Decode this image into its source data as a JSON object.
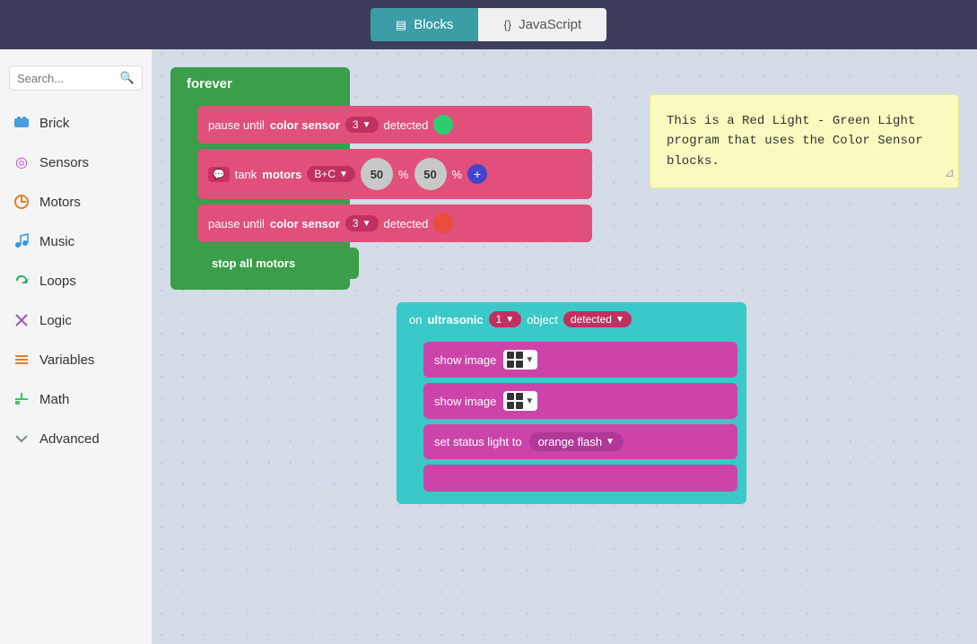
{
  "header": {
    "blocks_tab": "Blocks",
    "js_tab": "JavaScript",
    "blocks_icon": "▤",
    "js_icon": "{}"
  },
  "sidebar": {
    "search_placeholder": "Search...",
    "items": [
      {
        "id": "brick",
        "label": "Brick",
        "icon": "⬛",
        "color": "icon-brick"
      },
      {
        "id": "sensors",
        "label": "Sensors",
        "icon": "◎",
        "color": "icon-sensors"
      },
      {
        "id": "motors",
        "label": "Motors",
        "icon": "↻",
        "color": "icon-motors"
      },
      {
        "id": "music",
        "label": "Music",
        "icon": "♪",
        "color": "icon-music"
      },
      {
        "id": "loops",
        "label": "Loops",
        "icon": "↺",
        "color": "icon-loops"
      },
      {
        "id": "logic",
        "label": "Logic",
        "icon": "✕",
        "color": "icon-logic"
      },
      {
        "id": "variables",
        "label": "Variables",
        "icon": "≡",
        "color": "icon-variables"
      },
      {
        "id": "math",
        "label": "Math",
        "icon": "±",
        "color": "icon-math"
      },
      {
        "id": "advanced",
        "label": "Advanced",
        "icon": "∨",
        "color": "icon-advanced"
      }
    ]
  },
  "canvas": {
    "forever_label": "forever",
    "pause_until": "pause until",
    "color_sensor": "color sensor",
    "detected": "detected",
    "sensor_num_1": "3",
    "sensor_num_2": "3",
    "tank_motors": "tank",
    "motors_keyword": "motors",
    "motors_config": "B+C",
    "percent_1": "50",
    "percent_sym": "%",
    "percent_2": "50",
    "stop_all": "stop all motors",
    "on_label": "on",
    "ultrasonic": "ultrasonic",
    "ultra_num": "1",
    "object_label": "object",
    "ultra_detected": "detected",
    "show_image_1": "show image",
    "show_image_2": "show image",
    "set_status": "set status light to",
    "orange_flash": "orange flash",
    "note_text": "This is a Red Light - Green Light\nprogram that uses the Color Sensor\nblocks."
  }
}
